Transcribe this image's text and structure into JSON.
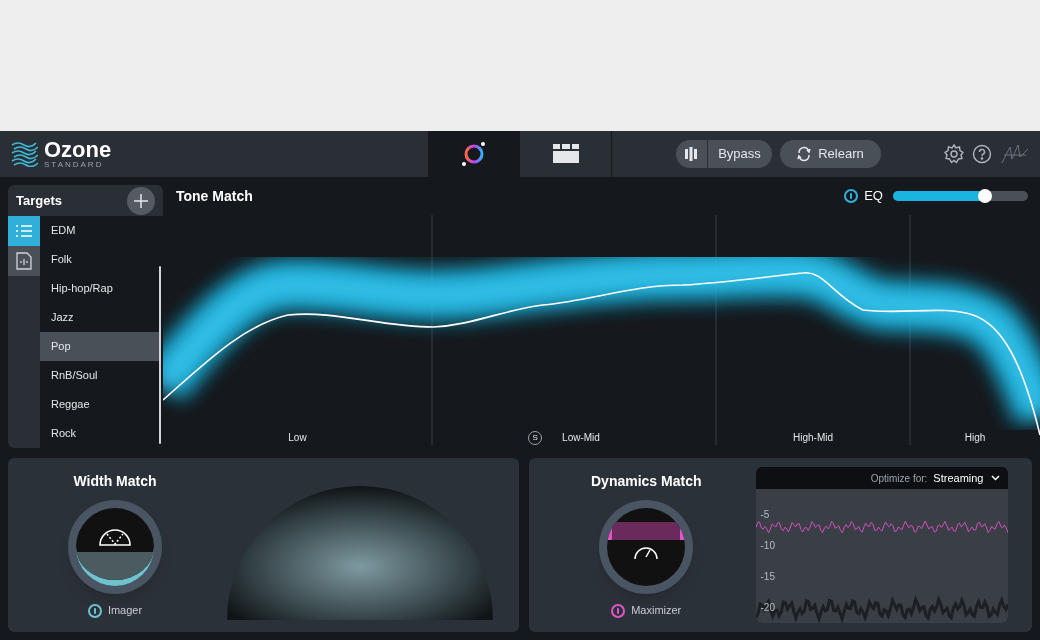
{
  "header": {
    "logo": "Ozone",
    "logo_sub": "STANDARD",
    "view_tabs": [
      {
        "kind": "match",
        "selected": true
      },
      {
        "kind": "modules",
        "selected": false
      }
    ],
    "bypass": "Bypass",
    "relearn": "Relearn"
  },
  "targets": {
    "title": "Targets",
    "modes": [
      {
        "kind": "list",
        "selected": true
      },
      {
        "kind": "file",
        "selected": false
      }
    ],
    "items": [
      {
        "label": "EDM",
        "selected": false
      },
      {
        "label": "Folk",
        "selected": false
      },
      {
        "label": "Hip-hop/Rap",
        "selected": false
      },
      {
        "label": "Jazz",
        "selected": false
      },
      {
        "label": "Pop",
        "selected": true
      },
      {
        "label": "RnB/Soul",
        "selected": false
      },
      {
        "label": "Reggae",
        "selected": false
      },
      {
        "label": "Rock",
        "selected": false
      }
    ]
  },
  "tone_match": {
    "title": "Tone Match",
    "eq": {
      "label": "EQ",
      "on": true,
      "level": 0.68
    },
    "solo": "S",
    "bands": [
      {
        "label": "Low"
      },
      {
        "label": "Low-Mid"
      },
      {
        "label": "High-Mid"
      },
      {
        "label": "High"
      }
    ]
  },
  "width_match": {
    "title": "Width Match",
    "module": "Imager",
    "on": true
  },
  "dynamics_match": {
    "title": "Dynamics Match",
    "module": "Maximizer",
    "on": true,
    "optimize_label": "Optimize for:",
    "optimize_value": "Streaming",
    "axis_labels": [
      "-5",
      "-10",
      "-15",
      "-20"
    ]
  }
}
